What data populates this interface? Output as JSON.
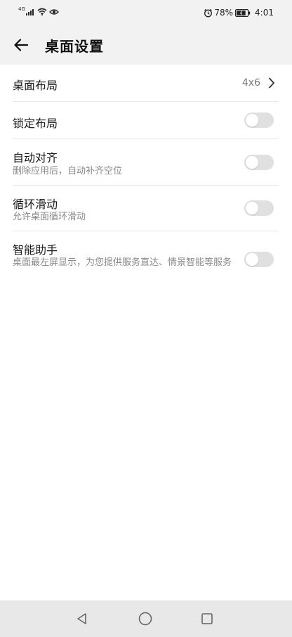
{
  "status_bar": {
    "network_type": "4G",
    "battery_percent": "78%",
    "time": "4:01",
    "icons": [
      "signal-icon",
      "wifi-icon",
      "eye-icon",
      "alarm-icon",
      "battery-icon"
    ]
  },
  "header": {
    "title": "桌面设置",
    "back_icon": "back-arrow-icon"
  },
  "settings": {
    "layout": {
      "label": "桌面布局",
      "value": "4x6"
    },
    "lock_layout": {
      "label": "锁定布局",
      "enabled": false
    },
    "auto_align": {
      "label": "自动对齐",
      "description": "删除应用后，自动补齐空位",
      "enabled": false
    },
    "loop_scroll": {
      "label": "循环滑动",
      "description": "允许桌面循环滑动",
      "enabled": false
    },
    "smart_assistant": {
      "label": "智能助手",
      "description": "桌面最左屏显示，为您提供服务直达、情景智能等服务",
      "enabled": false
    }
  },
  "nav_bar": {
    "buttons": [
      "back-triangle-icon",
      "home-circle-icon",
      "recents-square-icon"
    ]
  },
  "colors": {
    "background": "#f2f2f2",
    "content": "#ffffff",
    "toggle_off": "#e0e0e0",
    "secondary_text": "#8a8a8a"
  }
}
